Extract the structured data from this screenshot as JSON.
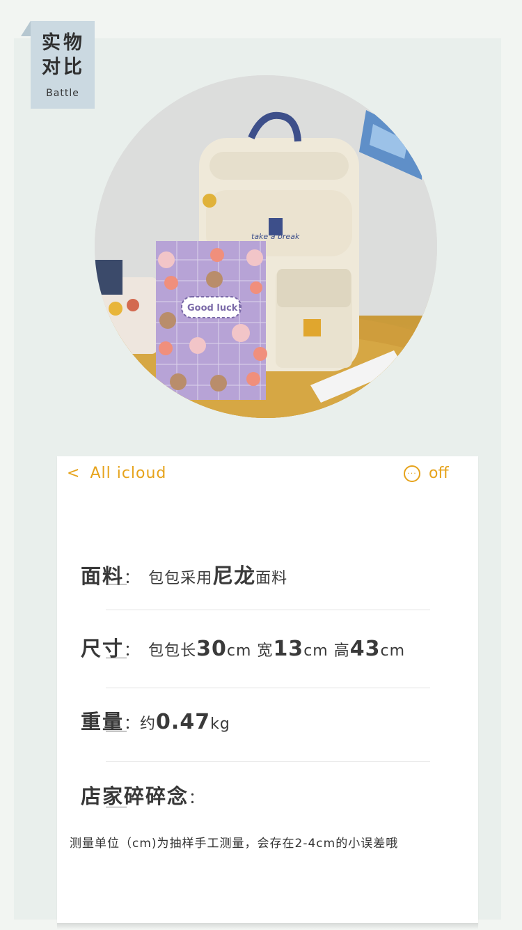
{
  "tag": {
    "title_line1": "实物",
    "title_line2": "对比",
    "subtitle": "Battle"
  },
  "photo": {
    "alt_visible_text_notebook": "Good luck!",
    "alt_visible_text_bag": "take a break"
  },
  "nav": {
    "back_chevron": "<",
    "back_label": "All icloud",
    "more_glyph": "···",
    "right_label": "off"
  },
  "rows": [
    {
      "label": "面料",
      "colon": "：",
      "text_a": "包包采用",
      "text_big": "尼龙",
      "text_b": "面料"
    },
    {
      "label": "尺寸",
      "colon": "：",
      "text": "包包长",
      "v1": "30",
      "u1": "cm",
      "t2": " 宽",
      "v2": "13",
      "u2": "cm",
      "t3": " 高",
      "v3": "43",
      "u3": "cm"
    },
    {
      "label": "重量",
      "colon": "：",
      "text": "约",
      "value": "0.47",
      "unit": "kg"
    },
    {
      "label": "店家碎碎念",
      "colon": "："
    }
  ],
  "note": "测量单位（cm)为抽样手工测量，会存在2-4cm的小误差哦",
  "colors": {
    "accent": "#e6a31b",
    "tag_bg": "#cbd9e1",
    "panel_bg": "#e9efec"
  }
}
